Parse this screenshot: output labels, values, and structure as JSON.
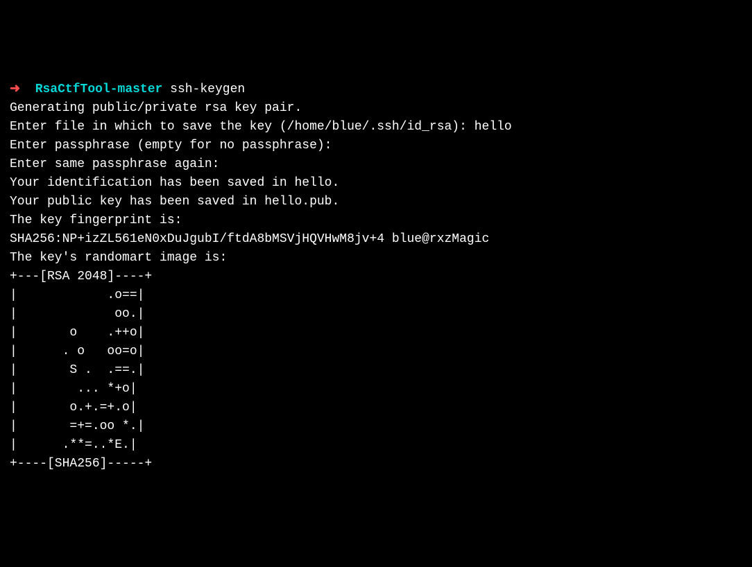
{
  "prompt": {
    "arrow": "➜",
    "directory": "RsaCtfTool-master",
    "command": "ssh-keygen"
  },
  "output": {
    "line1": "Generating public/private rsa key pair.",
    "line2": "Enter file in which to save the key (/home/blue/.ssh/id_rsa): hello",
    "line3": "Enter passphrase (empty for no passphrase):",
    "line4": "Enter same passphrase again:",
    "line5": "Your identification has been saved in hello.",
    "line6": "Your public key has been saved in hello.pub.",
    "line7": "The key fingerprint is:",
    "line8": "SHA256:NP+izZL561eN0xDuJgubI/ftdA8bMSVjHQVHwM8jv+4 blue@rxzMagic",
    "line9": "The key's randomart image is:",
    "art1": "+---[RSA 2048]----+",
    "art2": "|            .o==|",
    "art3": "|             oo.|",
    "art4": "|       o    .++o|",
    "art5": "|      . o   oo=o|",
    "art6": "|       S .  .==.|",
    "art7": "|        ... *+o|",
    "art8": "|       o.+.=+.o|",
    "art9": "|       =+=.oo *.|",
    "art10": "|      .**=..*E.|",
    "art11": "+----[SHA256]-----+"
  }
}
